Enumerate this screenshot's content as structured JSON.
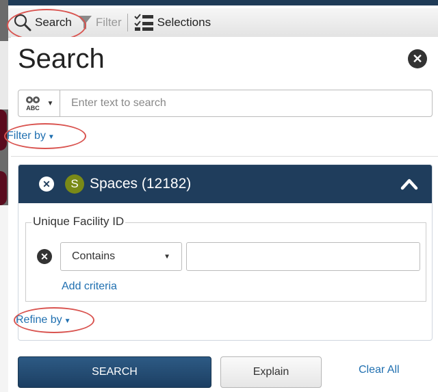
{
  "toolbar": {
    "search_label": "Search",
    "filter_label": "Filter",
    "selections_label": "Selections"
  },
  "panel": {
    "title": "Search",
    "search_placeholder": "Enter text to search",
    "filter_by": "Filter by",
    "refine_by": "Refine by"
  },
  "spaces": {
    "badge": "S",
    "title": "Spaces (12182)",
    "criteria_field": "Unique Facility ID",
    "operator": "Contains",
    "value": "",
    "add_criteria": "Add criteria"
  },
  "actions": {
    "search": "SEARCH",
    "explain": "Explain",
    "clear_all": "Clear All"
  },
  "colors": {
    "header_bg": "#1f3d5c",
    "link": "#1f6fb0",
    "badge_bg": "#7a8a17",
    "annotation": "#d9534f"
  }
}
